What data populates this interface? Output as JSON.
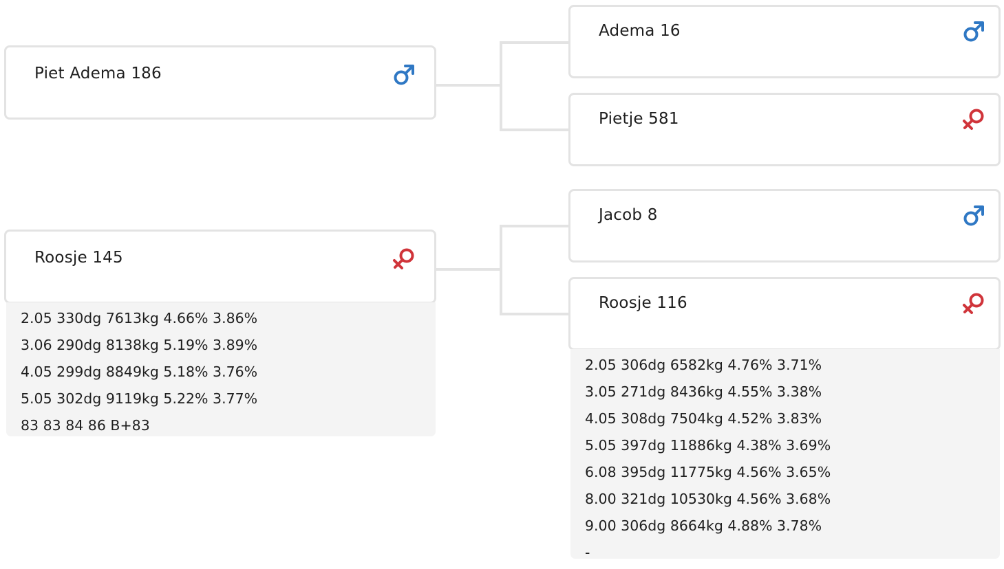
{
  "colors": {
    "male": "#2f78c4",
    "female": "#d0343a",
    "border": "#e3e3e3",
    "stats_bg": "#f4f4f4"
  },
  "nodes": {
    "root_1": {
      "name": "Piet Adema 186",
      "sex": "male-icon"
    },
    "root_1_parent_1": {
      "name": "Adema 16",
      "sex": "male-icon"
    },
    "root_1_parent_2": {
      "name": "Pietje 581",
      "sex": "female-icon"
    },
    "root_2": {
      "name": "Roosje 145",
      "sex": "female-icon",
      "stats": [
        "2.05 330dg 7613kg 4.66% 3.86%",
        "3.06 290dg 8138kg 5.19% 3.89%",
        "4.05 299dg 8849kg 5.18% 3.76%",
        "5.05 302dg 9119kg 5.22% 3.77%",
        "83 83 84 86 B+83"
      ]
    },
    "root_2_parent_1": {
      "name": "Jacob 8",
      "sex": "male-icon"
    },
    "root_2_parent_2": {
      "name": "Roosje 116",
      "sex": "female-icon",
      "stats": [
        "2.05 306dg 6582kg 4.76% 3.71%",
        "3.05 271dg 8436kg 4.55% 3.38%",
        "4.05 308dg 7504kg 4.52% 3.83%",
        "5.05 397dg 11886kg 4.38% 3.69%",
        "6.08 395dg 11775kg 4.56% 3.65%",
        "8.00 321dg 10530kg 4.56% 3.68%",
        "9.00 306dg 8664kg 4.88% 3.78%",
        "-"
      ]
    }
  }
}
